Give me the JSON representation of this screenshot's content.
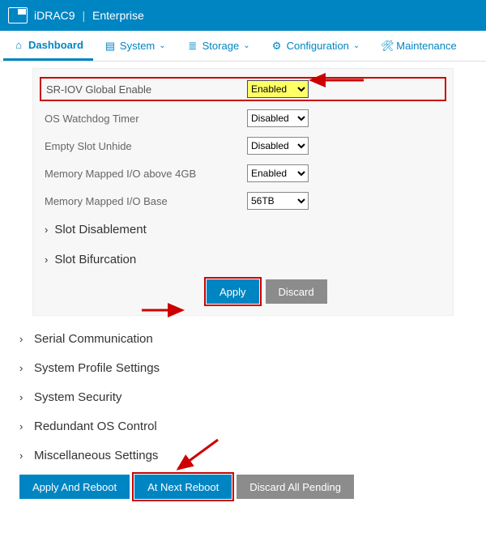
{
  "header": {
    "product": "iDRAC9",
    "tier": "Enterprise"
  },
  "nav": {
    "dashboard": "Dashboard",
    "system": "System",
    "storage": "Storage",
    "configuration": "Configuration",
    "maintenance": "Maintenance"
  },
  "settings": {
    "sriov": {
      "label": "SR-IOV Global Enable",
      "value": "Enabled"
    },
    "watchdog": {
      "label": "OS Watchdog Timer",
      "value": "Disabled"
    },
    "emptyslot": {
      "label": "Empty Slot Unhide",
      "value": "Disabled"
    },
    "mmio4gb": {
      "label": "Memory Mapped I/O above 4GB",
      "value": "Enabled"
    },
    "mmiobase": {
      "label": "Memory Mapped I/O Base",
      "value": "56TB"
    }
  },
  "sub_sections": {
    "slot_disablement": "Slot Disablement",
    "slot_bifurcation": "Slot Bifurcation"
  },
  "buttons": {
    "apply": "Apply",
    "discard": "Discard",
    "apply_reboot": "Apply And Reboot",
    "at_next_reboot": "At Next Reboot",
    "discard_all": "Discard All Pending"
  },
  "sections": {
    "serial": "Serial Communication",
    "profile": "System Profile Settings",
    "security": "System Security",
    "redundant": "Redundant OS Control",
    "misc": "Miscellaneous Settings"
  }
}
